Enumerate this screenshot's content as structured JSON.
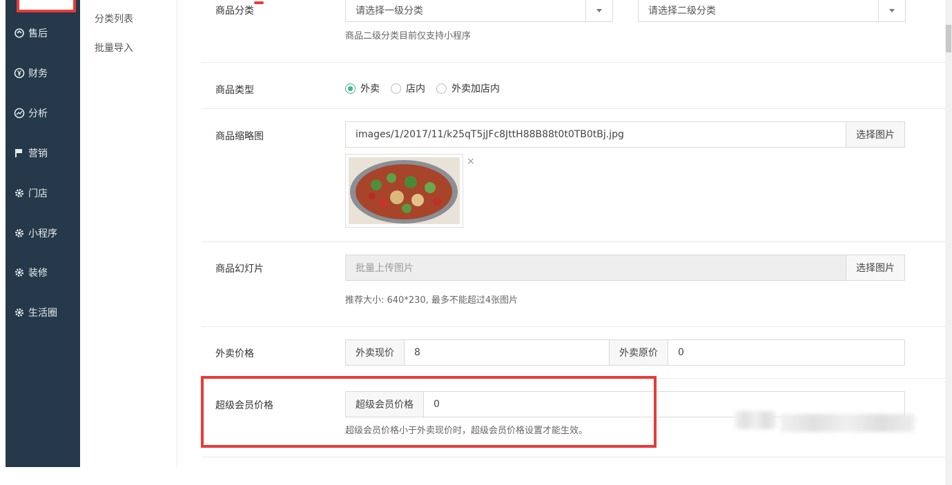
{
  "sidebar": {
    "items": [
      {
        "icon": "refresh-icon",
        "label": "售后"
      },
      {
        "icon": "yen-icon",
        "label": "财务"
      },
      {
        "icon": "chart-icon",
        "label": "分析"
      },
      {
        "icon": "flag-icon",
        "label": "营销"
      },
      {
        "icon": "gear-icon",
        "label": "门店"
      },
      {
        "icon": "gear-icon",
        "label": "小程序"
      },
      {
        "icon": "gear-icon",
        "label": "装修"
      },
      {
        "icon": "gear-icon",
        "label": "生活圈"
      }
    ]
  },
  "subnav": {
    "items": [
      "分类列表",
      "批量导入"
    ]
  },
  "form": {
    "category": {
      "label": "商品分类",
      "select1_placeholder": "请选择一级分类",
      "select2_placeholder": "请选择二级分类",
      "help": "商品二级分类目前仅支持小程序"
    },
    "type": {
      "label": "商品类型",
      "options": [
        {
          "label": "外卖",
          "checked": true
        },
        {
          "label": "店内",
          "checked": false
        },
        {
          "label": "外卖加店内",
          "checked": false
        }
      ]
    },
    "thumbnail": {
      "label": "商品缩略图",
      "value": "images/1/2017/11/k25qT5jJFc8JttH88B88t0t0TB0tBj.jpg",
      "button": "选择图片",
      "remove": "×"
    },
    "slides": {
      "label": "商品幻灯片",
      "placeholder": "批量上传图片",
      "button": "选择图片",
      "help": "推荐大小: 640*230, 最多不能超过4张图片"
    },
    "price": {
      "label": "外卖价格",
      "current_label": "外卖现价",
      "current_value": "8",
      "original_label": "外卖原价",
      "original_value": "0"
    },
    "vip_price": {
      "label": "超级会员价格",
      "addon": "超级会员价格",
      "value": "0",
      "help": "超级会员价格小于外卖现价时，超级会员价格设置才能生效。"
    }
  },
  "colors": {
    "sidebar_bg": "#25394b",
    "highlight_red": "#e93a3a",
    "radio_green": "#3bb78f"
  }
}
